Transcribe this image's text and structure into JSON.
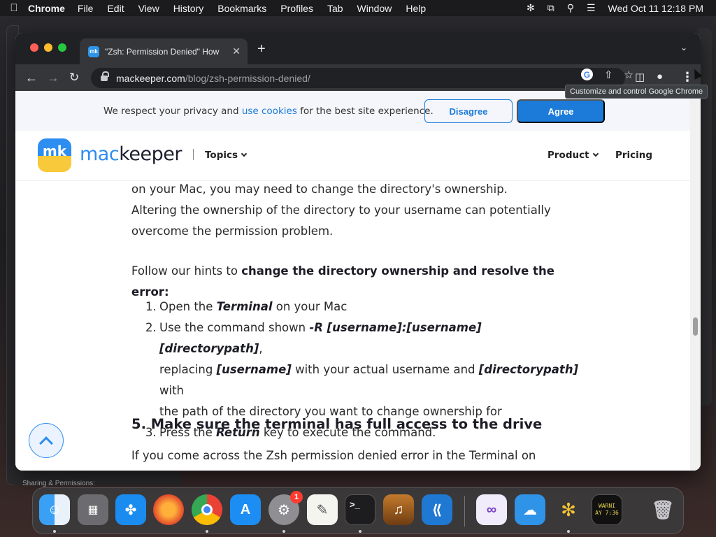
{
  "menubar": {
    "app_name": "Chrome",
    "items": [
      "File",
      "Edit",
      "View",
      "History",
      "Bookmarks",
      "Profiles",
      "Tab",
      "Window",
      "Help"
    ],
    "datetime": "Wed Oct 11  12:18 PM"
  },
  "background": {
    "finder_label": "Sharing & Permissions:"
  },
  "chrome": {
    "tab_title": "\"Zsh: Permission Denied\" How",
    "url_host": "mackeeper.com",
    "url_path": "/blog/zsh-permission-denied/",
    "tooltip": "Customize and control Google Chrome"
  },
  "cookie": {
    "text_before": "We respect your privacy and ",
    "link": "use cookies",
    "text_after": " for the best site experience.",
    "disagree": "Disagree",
    "agree": "Agree"
  },
  "site_header": {
    "logo_mark": "mk",
    "logo_mac": "mac",
    "logo_keeper": "keeper",
    "topics": "Topics",
    "product": "Product",
    "pricing": "Pricing"
  },
  "article": {
    "p_top_1": "on your Mac, you may need to change the directory's ownership.",
    "p_top_2": "Altering the ownership of the directory to your username can potentially",
    "p_top_3": "overcome the permission problem.",
    "hint_plain": "Follow our hints to ",
    "hint_bold": "change the directory ownership and resolve the error:",
    "step1_a": "Open the ",
    "step1_b": "Terminal",
    "step1_c": " on your Mac",
    "step2_a": "Use the command shown ",
    "step2_b": "-R [username]:[username] [directorypath]",
    "step2_c": ",",
    "step2_d": "replacing ",
    "step2_e": "[username]",
    "step2_f": " with your actual username and ",
    "step2_g": "[directorypath]",
    "step2_h": " with",
    "step2_i": "the path of the directory you want to change ownership for",
    "step3_a": "Press the ",
    "step3_b": "Return",
    "step3_c": " key to execute the command.",
    "heading5": "5. Make sure the terminal has full access to the drive",
    "p_bottom": "If you come across the Zsh permission denied error in the Terminal on"
  },
  "dock": {
    "settings_badge": "1",
    "console_text_1": "WARNI",
    "console_text_2": "AY 7:36"
  },
  "colors": {
    "accent": "#1c7bd9",
    "logo_blue": "#2d8df0",
    "logo_yellow": "#f8c93a"
  }
}
